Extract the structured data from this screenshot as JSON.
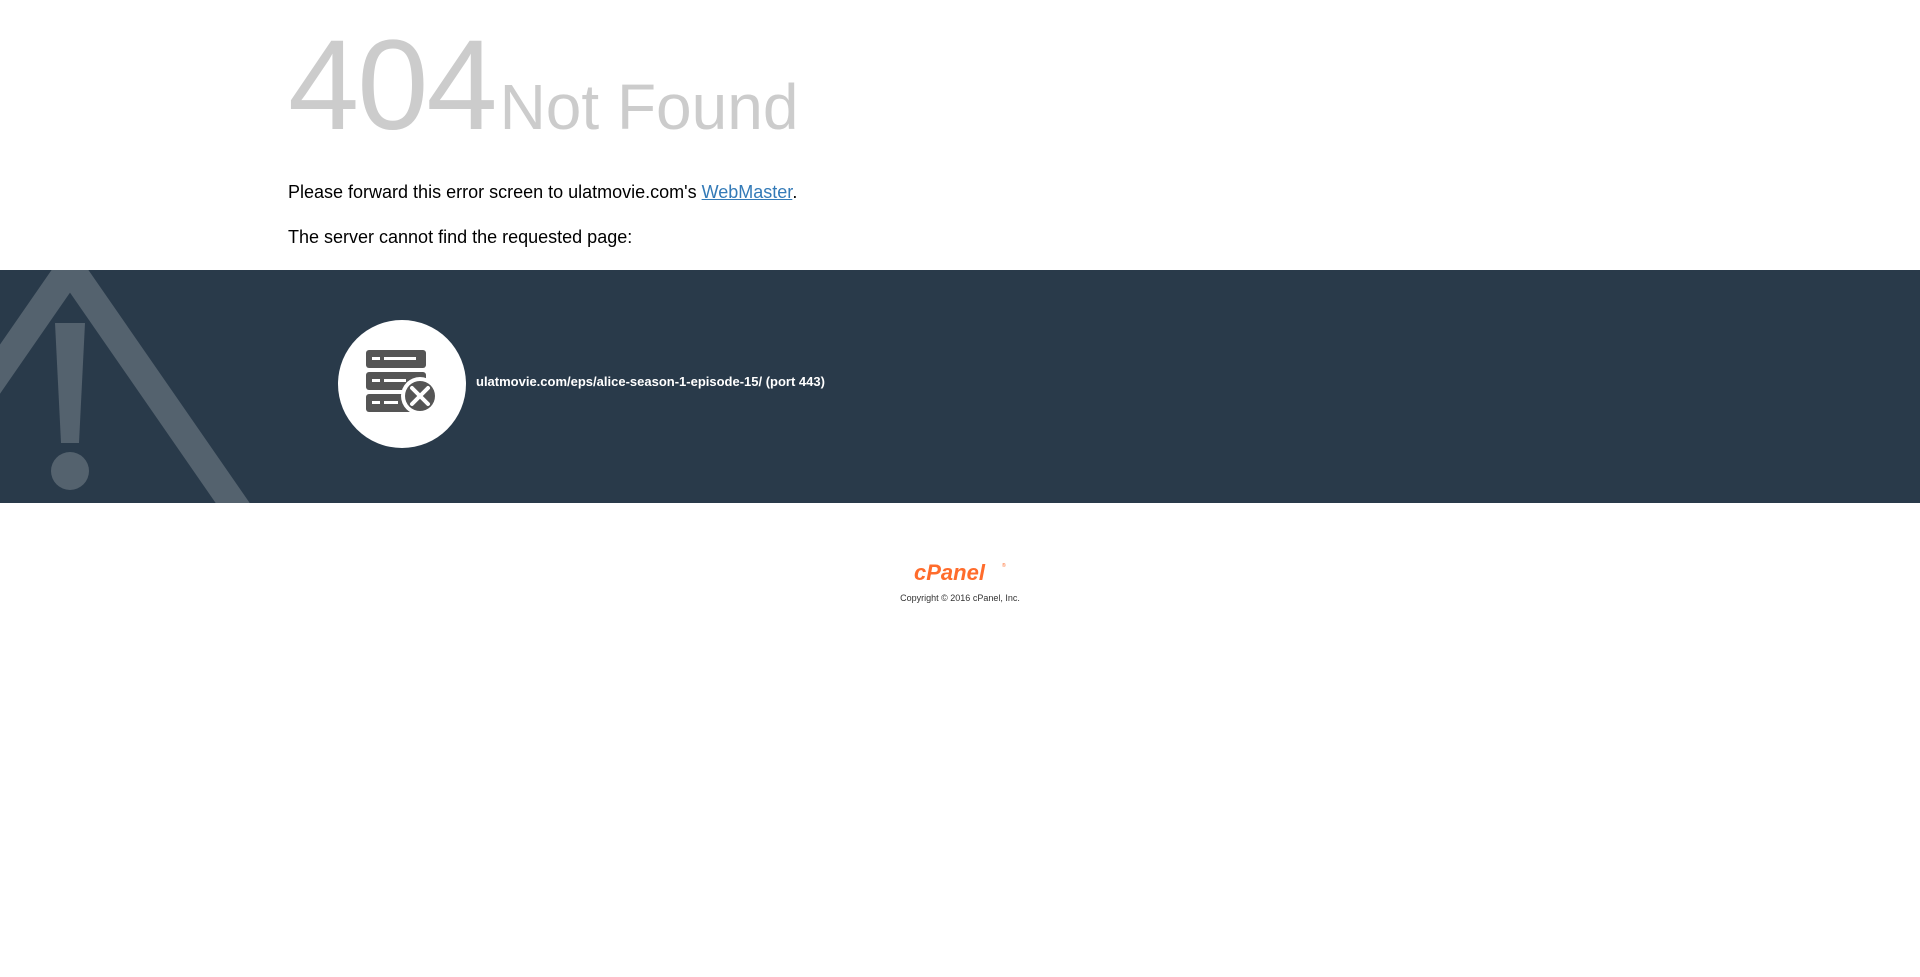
{
  "error": {
    "code": "404",
    "title": "Not Found"
  },
  "message": {
    "forward_prefix": "Please forward this error screen to ulatmovie.com's ",
    "webmaster_link": "WebMaster",
    "forward_suffix": ".",
    "not_found_text": "The server cannot find the requested page:"
  },
  "band": {
    "requested_url": "ulatmovie.com/eps/alice-season-1-episode-15/ (port 443)"
  },
  "footer": {
    "logo_text": "cPanel",
    "copyright": "Copyright © 2016 cPanel, Inc."
  },
  "colors": {
    "headline": "#cccccc",
    "link": "#337ab7",
    "band": "#293a4a",
    "brand": "#ff6c2c"
  },
  "icons": [
    "warning-triangle-icon",
    "server-error-icon"
  ]
}
